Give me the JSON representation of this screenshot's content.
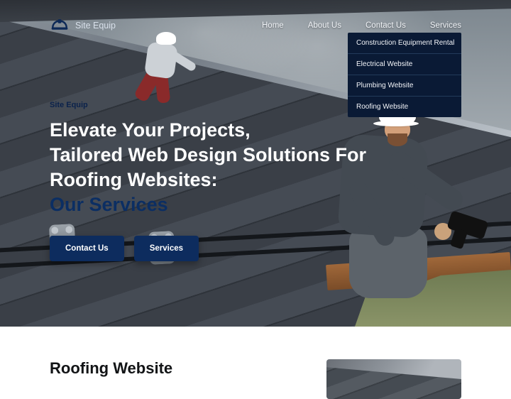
{
  "brand": {
    "name": "Site Equip"
  },
  "nav": {
    "items": [
      "Home",
      "About Us",
      "Contact Us",
      "Services"
    ]
  },
  "dropdown": {
    "items": [
      "Construction Equipment Rental",
      "Electrical Website",
      "Plumbing Website",
      "Roofing Website"
    ]
  },
  "hero": {
    "eyebrow": "Site Equip",
    "line1": "Elevate Your Projects,",
    "line2": "Tailored Web Design Solutions For",
    "line3": "Roofing Websites:",
    "highlight": "Our Services",
    "cta1": "Contact Us",
    "cta2": "Services"
  },
  "section2": {
    "title": "Roofing Website"
  }
}
